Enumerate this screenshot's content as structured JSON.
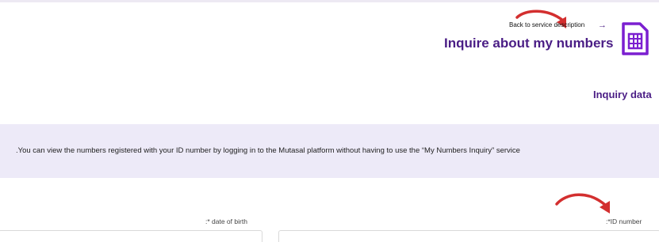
{
  "header": {
    "back_link": "Back to service description",
    "back_arrow": "→",
    "title": "Inquire about my numbers",
    "icon": "sim-card-icon"
  },
  "section": {
    "title": "Inquiry data"
  },
  "info": {
    "text": ".You can view the numbers registered with your ID number by logging in to the Mutasal platform without having to use the “My Numbers Inquiry” service"
  },
  "form": {
    "dob_label": ":* date of birth",
    "id_label": ":*ID number"
  },
  "colors": {
    "brand": "#4a1d85",
    "banner_bg": "#edeaf8",
    "annotation_arrow": "#d32f2f"
  }
}
